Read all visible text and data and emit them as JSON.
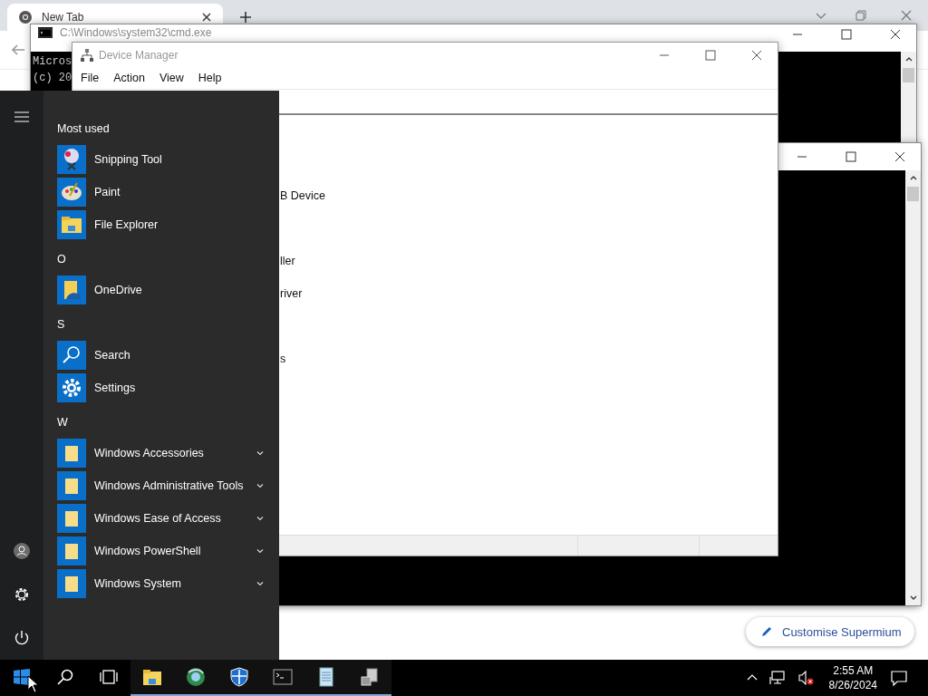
{
  "browser": {
    "tab": {
      "title": "New Tab",
      "selected": true
    },
    "customise_button": "Customise Supermium"
  },
  "console": {
    "title": "C:\\Windows\\system32\\cmd.exe",
    "lines": [
      "Micros",
      "(c) 20"
    ]
  },
  "device_manager": {
    "title": "Device Manager",
    "menu": [
      "File",
      "Action",
      "View",
      "Help"
    ],
    "tree_items": [
      "B Device",
      "ller",
      "river",
      "s"
    ]
  },
  "start_menu": {
    "groups": [
      {
        "heading": "Most used",
        "apps": [
          {
            "name": "Snipping Tool",
            "kind": "snip",
            "expandable": false
          },
          {
            "name": "Paint",
            "kind": "paint",
            "expandable": false
          },
          {
            "name": "File Explorer",
            "kind": "explorer",
            "expandable": false
          }
        ]
      },
      {
        "heading": "O",
        "apps": [
          {
            "name": "OneDrive",
            "kind": "onedrive",
            "expandable": false
          }
        ]
      },
      {
        "heading": "S",
        "apps": [
          {
            "name": "Search",
            "kind": "search",
            "expandable": false
          },
          {
            "name": "Settings",
            "kind": "settings",
            "expandable": false
          }
        ]
      },
      {
        "heading": "W",
        "apps": [
          {
            "name": "Windows Accessories",
            "kind": "folder",
            "expandable": true
          },
          {
            "name": "Windows Administrative Tools",
            "kind": "folder",
            "expandable": true
          },
          {
            "name": "Windows Ease of Access",
            "kind": "folder",
            "expandable": true
          },
          {
            "name": "Windows PowerShell",
            "kind": "folder",
            "expandable": true
          },
          {
            "name": "Windows System",
            "kind": "folder",
            "expandable": true
          }
        ]
      }
    ]
  },
  "taskbar": {
    "apps": [
      {
        "kind": "start",
        "running": false
      },
      {
        "kind": "search",
        "running": false
      },
      {
        "kind": "taskview",
        "running": false
      },
      {
        "kind": "explorer",
        "running": true
      },
      {
        "kind": "globe",
        "running": true
      },
      {
        "kind": "shield",
        "running": true
      },
      {
        "kind": "console",
        "running": true
      },
      {
        "kind": "notepad",
        "running": true
      },
      {
        "kind": "devmgr",
        "running": true
      }
    ],
    "time": "2:55 AM",
    "date": "8/26/2024"
  }
}
